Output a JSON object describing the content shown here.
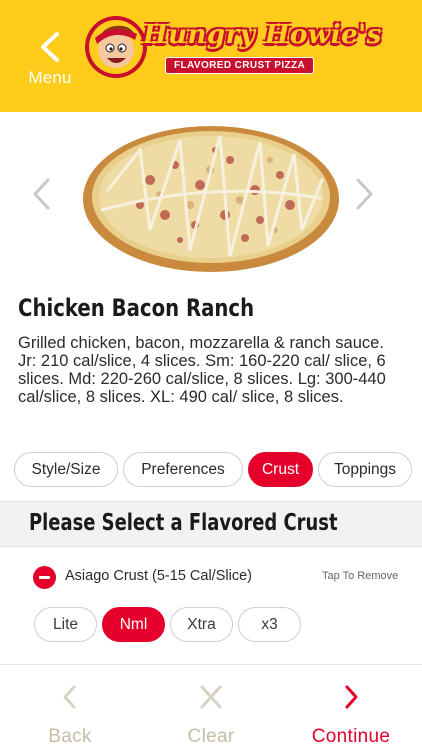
{
  "header": {
    "back_label": "Menu",
    "brand_name": "Hungry Howie's",
    "brand_tagline": "FLAVORED CRUST PIZZA",
    "brand_color": "#FFCC1B",
    "accent_color": "#E4002B"
  },
  "hero": {
    "prev_icon": "chevron-left-icon",
    "next_icon": "chevron-right-icon"
  },
  "item": {
    "title": "Chicken Bacon Ranch",
    "description": "Grilled chicken, bacon, mozzarella & ranch sauce.",
    "nutrition": "Jr: 210 cal/slice, 4 slices. Sm: 160-220 cal/ slice, 6 slices. Md: 220-260 cal/slice, 8 slices. Lg: 300-440 cal/slice, 8 slices. XL: 490 cal/ slice, 8 slices."
  },
  "tabs": [
    {
      "label": "Style/Size",
      "active": false
    },
    {
      "label": "Preferences",
      "active": false
    },
    {
      "label": "Crust",
      "active": true
    },
    {
      "label": "Toppings",
      "active": false
    }
  ],
  "section": {
    "title": "Please Select a Flavored Crust"
  },
  "crust": {
    "selected": "Asiago Crust (5-15 Cal/Slice)",
    "tap_remove": "Tap To Remove",
    "amounts": [
      {
        "label": "Lite",
        "active": false
      },
      {
        "label": "Nml",
        "active": true
      },
      {
        "label": "Xtra",
        "active": false
      },
      {
        "label": "x3",
        "active": false
      }
    ]
  },
  "bottom_nav": {
    "back": "Back",
    "clear": "Clear",
    "continue": "Continue"
  }
}
